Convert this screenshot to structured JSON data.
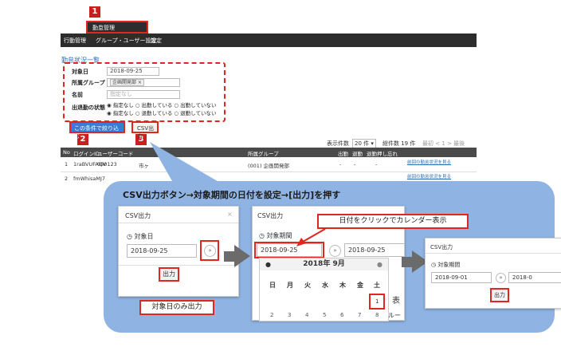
{
  "badges": [
    "1",
    "2",
    "3"
  ],
  "app": {
    "header_label": "勤怠管理",
    "nav_items": [
      "行動管理",
      "グループ・ユーザー設定",
      "設定"
    ],
    "section_title": "勤怠状況一覧"
  },
  "filter": {
    "date_label": "対象日",
    "date_value": "2018-09-25",
    "group_label": "所属グループ",
    "group_tag": "企画開発部 ×",
    "name_label": "名前",
    "name_placeholder": "指定なし",
    "status_label": "出退勤の状態",
    "status_line1": "◉ 指定なし ○ 出勤している ○ 出勤していない",
    "status_line2": "◉ 指定なし ○ 退勤している ○ 退勤していない",
    "search_button": "この条件で絞り込む",
    "csv_button": "CSV出力"
  },
  "pagination": {
    "per_page_label": "表示件数",
    "per_page_value": "20 件 ▾",
    "total_label": "総件数 19 件",
    "pager": "最初 < 1 > 最後"
  },
  "table": {
    "headers": [
      "No",
      "ログインID",
      "ユーザーコード",
      "所属グループ",
      "出勤",
      "退勤",
      "退勤押し忘れ"
    ],
    "rows": [
      {
        "no": "1",
        "login": "1raBVUFAQV",
        "code": "000123",
        "name": "市ヶ",
        "group": "(001) 企画開発部",
        "in": "-",
        "out": "-",
        "forgot": "-",
        "link": "前回の勤怠状況を見る"
      },
      {
        "no": "2",
        "login": "fmWhisaMJ7",
        "code": "",
        "name": "",
        "group": "",
        "in": "",
        "out": "",
        "forgot": "",
        "link": "前回の勤怠状況を見る"
      }
    ]
  },
  "panel": {
    "title": "CSV出力ボタン→対象期間の日付を設定→[出力]を押す"
  },
  "modal1": {
    "title": "CSV出力",
    "close": "×",
    "field_label": "対象日",
    "date": "2018-09-25",
    "output_button": "出力",
    "callout": "対象日のみ出力"
  },
  "modal2": {
    "title": "CSV出力",
    "field_label": "対象期間",
    "from": "2018-09-25",
    "to": "2018-09-25",
    "callout": "日付をクリックでカレンダー表示",
    "cal_month": "2018年 9月",
    "dow": [
      "日",
      "月",
      "火",
      "水",
      "木",
      "金",
      "土"
    ],
    "first_day": "1",
    "week2": [
      "2",
      "3",
      "4",
      "5",
      "6",
      "7",
      "8"
    ],
    "cut_text": "表",
    "cut_text2": "ルー"
  },
  "modal3": {
    "title": "CSV出力",
    "field_label": "対象期間",
    "from": "2018-09-01",
    "to": "2018-0",
    "output_button": "出力"
  },
  "colors": {
    "accent_red": "#e0261f",
    "panel_blue": "#8fb4e3",
    "nav_dark": "#2d2d2d",
    "button_blue": "#3a7bd5"
  }
}
